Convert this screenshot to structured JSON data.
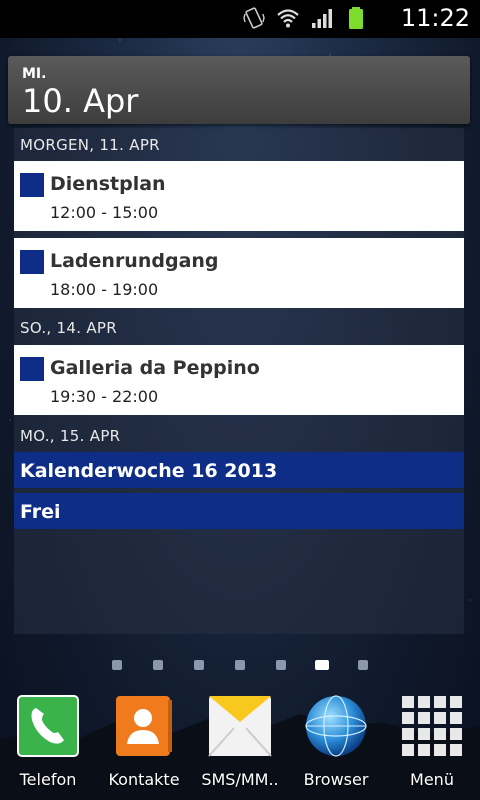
{
  "status_bar": {
    "time": "11:22",
    "icons": [
      "vibrate-icon",
      "wifi-icon",
      "signal-icon",
      "battery-icon"
    ]
  },
  "widget": {
    "header": {
      "day_of_week": "MI.",
      "date": "10. Apr"
    },
    "days": [
      {
        "label": "MORGEN, 11. APR"
      },
      {
        "label": "SO., 14. APR"
      },
      {
        "label": "MO., 15. APR"
      }
    ],
    "events": [
      {
        "title": "Dienstplan",
        "time": "12:00 - 15:00"
      },
      {
        "title": "Ladenrundgang",
        "time": "18:00 - 19:00"
      },
      {
        "title": "Galleria da Peppino",
        "time": "19:30 - 22:00"
      }
    ],
    "all_day": [
      "Kalenderwoche 16 2013",
      "Frei"
    ],
    "event_color": "#0d2d86"
  },
  "home": {
    "pages": 7,
    "current_page": 6
  },
  "dock": {
    "apps": [
      {
        "label": "Telefon",
        "icon": "phone-icon"
      },
      {
        "label": "Kontakte",
        "icon": "contacts-icon"
      },
      {
        "label": "SMS/MM..",
        "icon": "messaging-icon"
      },
      {
        "label": "Browser",
        "icon": "browser-globe-icon"
      },
      {
        "label": "Menü",
        "icon": "app-grid-icon"
      }
    ]
  }
}
